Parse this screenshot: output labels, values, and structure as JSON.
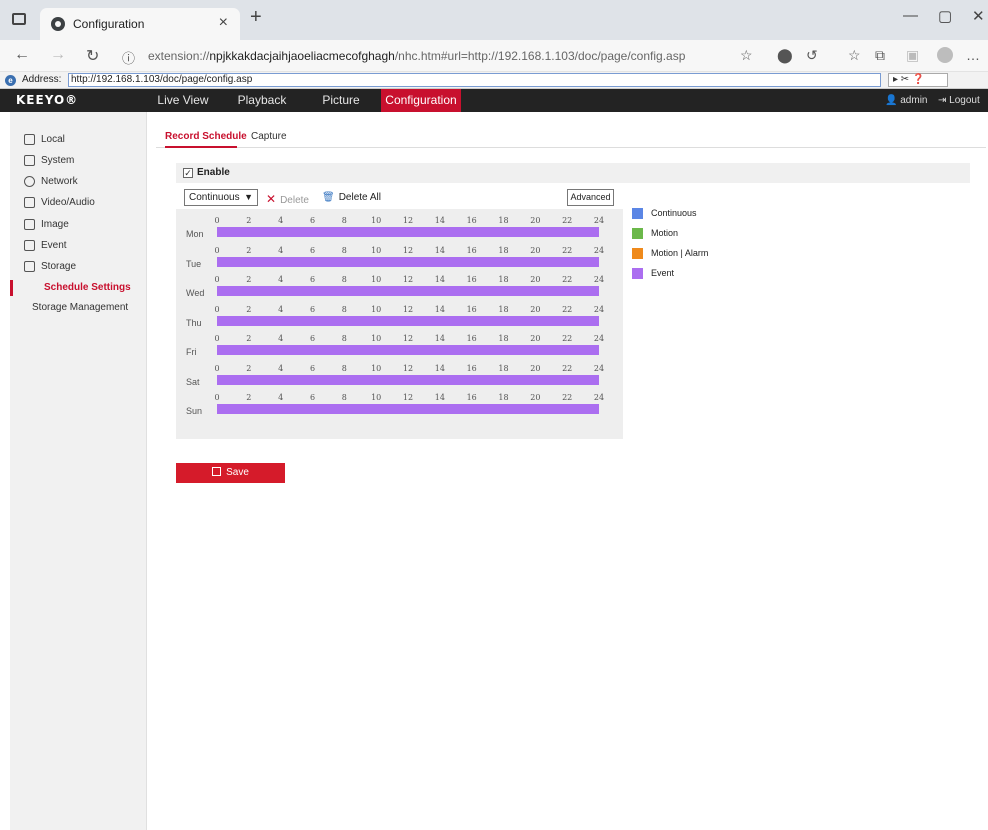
{
  "browser": {
    "tab_title": "Configuration",
    "tab_close": "×",
    "new_tab": "+",
    "url_prefix": "extension://",
    "url_main": "npjkkakdacjaihjaoeliacmecofghagh",
    "url_rest": "/nhc.htm#url=http://192.168.1.103/doc/page/config.asp",
    "window": {
      "minimize": "—",
      "maximize": "▢",
      "close": "✕"
    }
  },
  "address_bar": {
    "label": "Address:",
    "url": "http://192.168.1.103/doc/page/config.asp",
    "tools": "▸ ✂ ❓"
  },
  "app": {
    "logo": "KEEYO®",
    "menu": [
      {
        "label": "Live View"
      },
      {
        "label": "Playback"
      },
      {
        "label": "Picture"
      },
      {
        "label": "Configuration"
      }
    ],
    "user": "admin",
    "logout": "Logout"
  },
  "sidebar": {
    "items": [
      {
        "label": "Local"
      },
      {
        "label": "System"
      },
      {
        "label": "Network"
      },
      {
        "label": "Video/Audio"
      },
      {
        "label": "Image"
      },
      {
        "label": "Event"
      },
      {
        "label": "Storage"
      },
      {
        "label": "Schedule Settings"
      },
      {
        "label": "Storage Management"
      }
    ]
  },
  "content": {
    "tabs": [
      {
        "label": "Record Schedule"
      },
      {
        "label": "Capture"
      }
    ],
    "enable_label": "Enable",
    "enable_checked": "✓",
    "select_value": "Continuous",
    "delete_label": "Delete",
    "delete_all_label": "Delete All",
    "advanced_label": "Advanced",
    "save_label": "Save",
    "days": [
      "Mon",
      "Tue",
      "Wed",
      "Thu",
      "Fri",
      "Sat",
      "Sun"
    ],
    "hours": [
      "0",
      "2",
      "4",
      "6",
      "8",
      "10",
      "12",
      "14",
      "16",
      "18",
      "20",
      "22",
      "24"
    ],
    "legend": [
      {
        "label": "Continuous",
        "color": "#5b86e5"
      },
      {
        "label": "Motion",
        "color": "#6bb84a"
      },
      {
        "label": "Motion | Alarm",
        "color": "#ef8a1c"
      },
      {
        "label": "Event",
        "color": "#ab6ef0"
      }
    ]
  }
}
